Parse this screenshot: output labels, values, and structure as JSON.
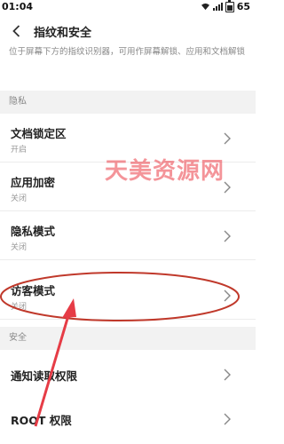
{
  "status_bar": {
    "time": "01:04",
    "battery": "65"
  },
  "header": {
    "title": "指纹和安全"
  },
  "description": "位于屏幕下方的指纹识别器，可用作屏幕解锁、应用和文档解锁",
  "sections": [
    {
      "title": "隐私",
      "items": [
        {
          "label": "文档锁定区",
          "sub": "开启"
        },
        {
          "label": "应用加密",
          "sub": "关闭"
        },
        {
          "label": "隐私模式",
          "sub": "关闭"
        },
        {
          "label": "访客模式",
          "sub": "关闭"
        }
      ]
    },
    {
      "title": "安全",
      "items": [
        {
          "label": "通知读取权限"
        },
        {
          "label": "ROOT 权限"
        }
      ]
    }
  ],
  "watermark": "天美资源网",
  "colors": {
    "annotation": "#c0392b",
    "arrow": "#e63c46",
    "section_bg": "#f2f2f2"
  }
}
